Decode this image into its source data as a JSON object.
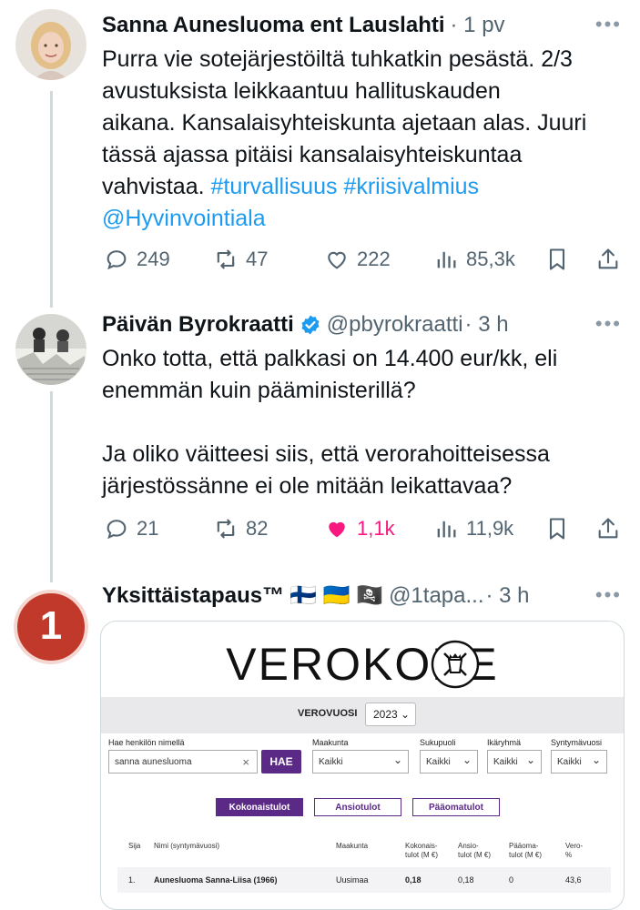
{
  "tweets": [
    {
      "author": "Sanna Aunesluoma ent Lauslahti",
      "meta": "· 1 pv",
      "text": "Purra vie sotejärjestöiltä tuhkatkin pesästä. 2/3\navustuksista leikkaantuu hallituskauden\naikana. Kansalaisyhteiskunta ajetaan alas. Juuri\ntässä ajassa pitäisi kansalaisyhteiskuntaa\nvahvistaa. ",
      "hashtags": "#turvallisuus #kriisivalmius",
      "mention": "@Hyvinvointiala",
      "replies": "249",
      "retweets": "47",
      "likes": "222",
      "views": "85,3k"
    },
    {
      "author": "Päivän Byrokraatti",
      "handle": "@pbyrokraatti",
      "meta": "· 3 h",
      "text": "Onko totta, että palkkasi on 14.400 eur/kk, eli\nenemmän kuin pääministerillä?\n\nJa oliko väitteesi siis, että verorahoitteisessa\njärjestössänne ei ole mitään leikattavaa?",
      "replies": "21",
      "retweets": "82",
      "likes": "1,1k",
      "views": "11,9k"
    },
    {
      "author": "Yksittäistapaus™",
      "flags": "🇫🇮 🇺🇦 🏴‍☠️",
      "handle": "@1tapa...",
      "meta": "· 3 h",
      "badge": "1"
    }
  ],
  "verokone": {
    "logo": "VEROKONE",
    "year_label": "VEROVUOSI",
    "year": "2023",
    "search_label": "Hae henkilön nimellä",
    "search_value": "sanna aunesluoma",
    "clear": "×",
    "search_button": "HAE",
    "filters": [
      {
        "label": "Maakunta",
        "value": "Kaikki"
      },
      {
        "label": "Sukupuoli",
        "value": "Kaikki"
      },
      {
        "label": "Ikäryhmä",
        "value": "Kaikki"
      },
      {
        "label": "Syntymävuosi",
        "value": "Kaikki"
      }
    ],
    "tabs": [
      "Kokonaistulot",
      "Ansiotulot",
      "Pääomatulot"
    ],
    "columns": [
      "Sija",
      "Nimi (syntymävuosi)",
      "Maakunta",
      "Kokonais-\ntulot (M €)",
      "Ansio-\ntulot (M €)",
      "Pääoma-\ntulot (M €)",
      "Vero-\n%"
    ],
    "row": {
      "rank": "1.",
      "name": "Aunesluoma Sanna-Liisa (1966)",
      "region": "Uusimaa",
      "total": "0,18",
      "earned": "0,18",
      "capital": "0",
      "tax": "43,6"
    }
  },
  "colors": {
    "link": "#1d9bf0",
    "like": "#f91880",
    "verokone_purple": "#5b2a86",
    "badge": "#c0392b"
  }
}
